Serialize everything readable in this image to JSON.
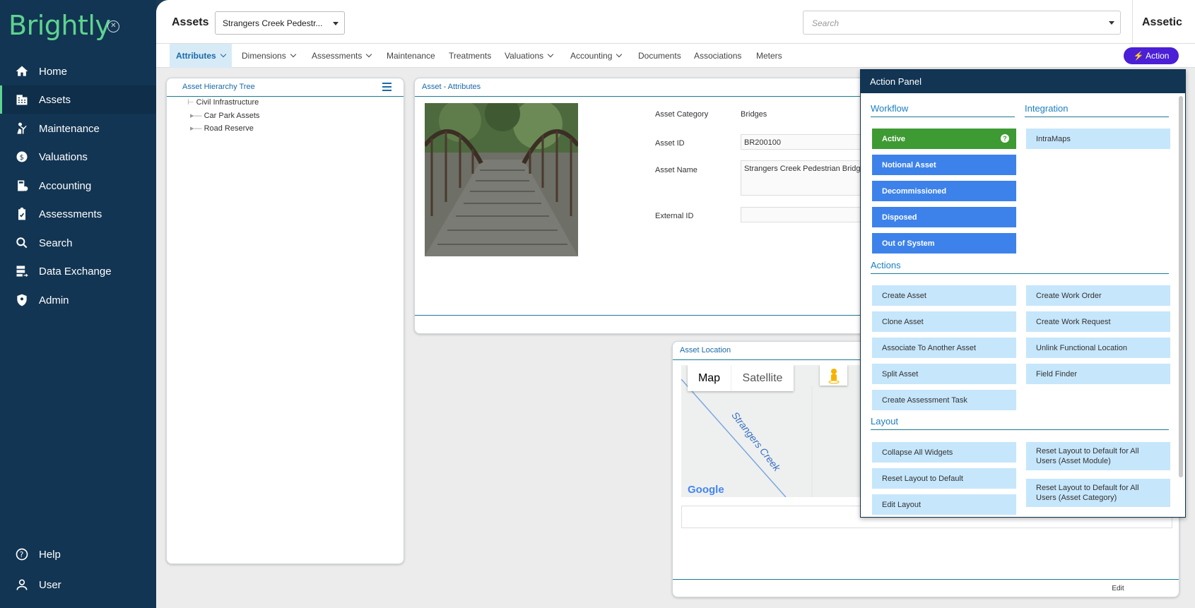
{
  "sidebar": {
    "logo": "Brightly",
    "items": [
      {
        "label": "Home",
        "icon": "home-icon"
      },
      {
        "label": "Assets",
        "icon": "building-icon"
      },
      {
        "label": "Maintenance",
        "icon": "worker-icon"
      },
      {
        "label": "Valuations",
        "icon": "valuation-icon"
      },
      {
        "label": "Accounting",
        "icon": "accounting-icon"
      },
      {
        "label": "Assessments",
        "icon": "clipboard-icon"
      },
      {
        "label": "Search",
        "icon": "search-icon"
      },
      {
        "label": "Data Exchange",
        "icon": "data-exchange-icon"
      },
      {
        "label": "Admin",
        "icon": "shield-icon"
      }
    ],
    "help": "Help",
    "user": "User"
  },
  "header": {
    "module_title": "Assets",
    "asset_select": "Strangers Creek Pedestr...",
    "search_placeholder": "Search",
    "brand": "Assetic"
  },
  "tabs": [
    {
      "label": "Attributes",
      "dropdown": true
    },
    {
      "label": "Dimensions",
      "dropdown": true
    },
    {
      "label": "Assessments",
      "dropdown": true
    },
    {
      "label": "Maintenance",
      "dropdown": false
    },
    {
      "label": "Treatments",
      "dropdown": false
    },
    {
      "label": "Valuations",
      "dropdown": true
    },
    {
      "label": "Accounting",
      "dropdown": true
    },
    {
      "label": "Documents",
      "dropdown": false
    },
    {
      "label": "Associations",
      "dropdown": false
    },
    {
      "label": "Meters",
      "dropdown": false
    }
  ],
  "action_button": "Action",
  "hierarchy": {
    "title": "Asset Hierarchy Tree",
    "nodes": [
      "Civil Infrastructure",
      "Car Park Assets",
      "Road Reserve"
    ]
  },
  "attributes": {
    "title": "Asset - Attributes",
    "category_label": "Asset Category",
    "category_value": "Bridges",
    "id_label": "Asset ID",
    "id_value": "BR200100",
    "name_label": "Asset Name",
    "name_value": "Strangers Creek Pedestrian Bridge",
    "external_label": "External ID",
    "external_value": ""
  },
  "location": {
    "title": "Asset Location",
    "map_btn": "Map",
    "satellite_btn": "Satellite",
    "street_label": "Strangers Creek",
    "google": "Google",
    "edit": "Edit"
  },
  "action_panel": {
    "title": "Action Panel",
    "workflow_title": "Workflow",
    "integration_title": "Integration",
    "workflow": [
      "Active",
      "Notional Asset",
      "Decommissioned",
      "Disposed",
      "Out of System"
    ],
    "integration": [
      "IntraMaps"
    ],
    "actions_title": "Actions",
    "actions_left": [
      "Create Asset",
      "Clone Asset",
      "Associate To Another Asset",
      "Split Asset",
      "Create Assessment Task"
    ],
    "actions_right": [
      "Create Work Order",
      "Create Work Request",
      "Unlink Functional Location",
      "Field Finder"
    ],
    "layout_title": "Layout",
    "layout_left": [
      "Collapse All Widgets",
      "Reset Layout to Default",
      "Edit Layout"
    ],
    "layout_right": [
      "Reset Layout to Default for All Users (Asset Module)",
      "Reset Layout to Default for All Users (Asset Category)"
    ],
    "colors": {
      "active": "#3e9a33",
      "status": "#3d82ea",
      "action": "#c6e6fb",
      "header": "#123553"
    }
  }
}
